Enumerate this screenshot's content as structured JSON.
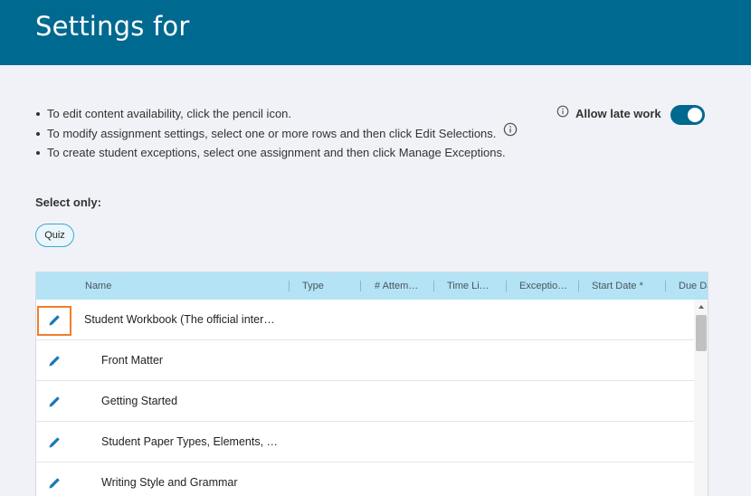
{
  "header": {
    "title": "Settings for"
  },
  "instructions": [
    "To edit content availability, click the pencil icon.",
    "To modify assignment settings, select one or more rows and then click Edit Selections.",
    "To create student exceptions, select one assignment and then click Manage Exceptions."
  ],
  "late_work": {
    "label": "Allow late work",
    "enabled": true
  },
  "filter": {
    "label": "Select only:",
    "chips": [
      "Quiz"
    ]
  },
  "table": {
    "columns": [
      "Name",
      "Type",
      "# Attem…",
      "Time Li…",
      "Exceptio…",
      "Start Date *",
      "Due Da"
    ],
    "rows": [
      {
        "name": "Student Workbook (The official inter…"
      },
      {
        "name": "Front Matter"
      },
      {
        "name": "Getting Started"
      },
      {
        "name": "Student Paper Types, Elements, …"
      },
      {
        "name": "Writing Style and Grammar"
      }
    ]
  },
  "colors": {
    "header": "#00698f",
    "accent": "#00698f",
    "table_header": "#b3e3f5",
    "focus_outline": "#f07f2a"
  },
  "icons": {
    "info": "info-circle-icon",
    "edit": "pencil-icon"
  }
}
